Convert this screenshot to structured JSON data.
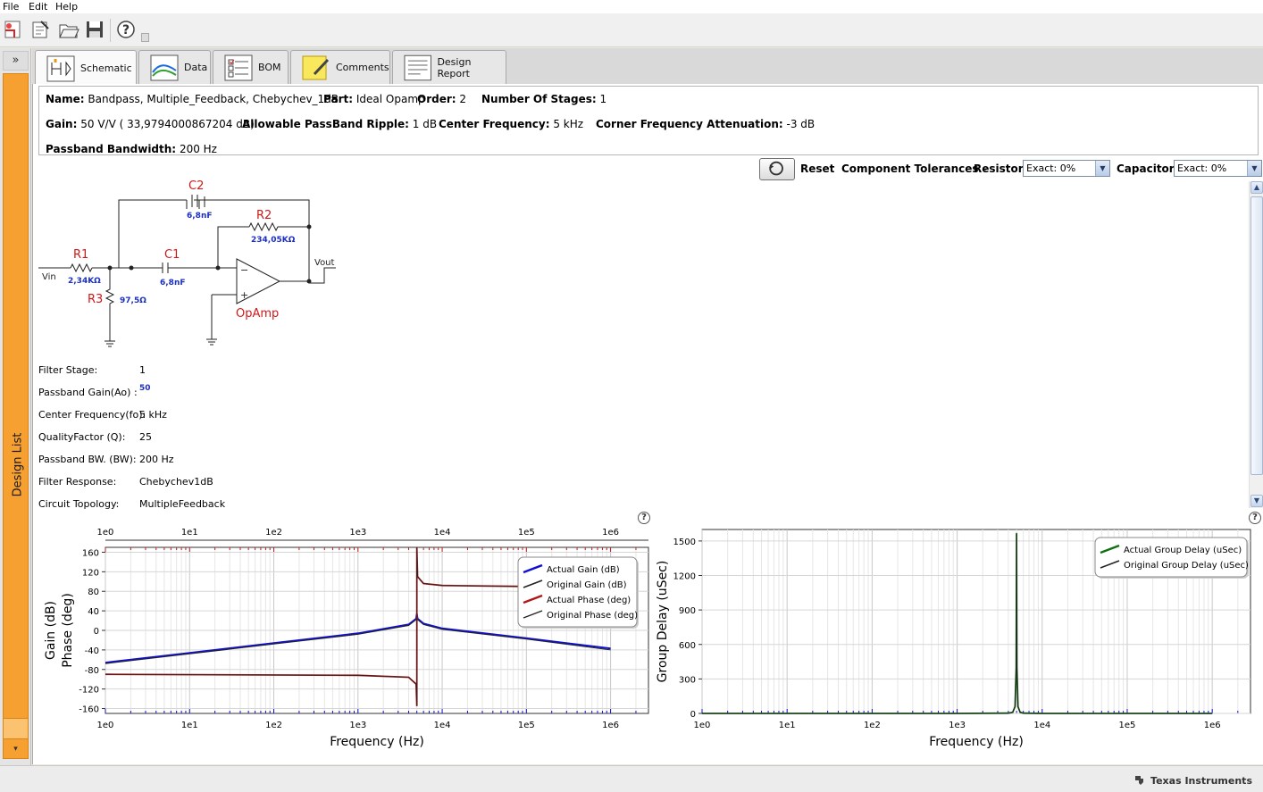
{
  "menu": [
    "File",
    "Edit",
    "Help"
  ],
  "toolbar_icons": [
    "new-design-icon",
    "edit-design-icon",
    "open-folder-icon",
    "save-disk-icon",
    "help-icon"
  ],
  "sidebar": {
    "expand": "»",
    "label": "Design List"
  },
  "tabs": [
    {
      "label": "Schematic",
      "icon": "schematic-icon"
    },
    {
      "label": "Data",
      "icon": "data-chart-icon"
    },
    {
      "label": "BOM",
      "icon": "bom-list-icon"
    },
    {
      "label": "Comments",
      "icon": "comments-note-icon"
    },
    {
      "label": "Design Report",
      "icon": "report-icon"
    }
  ],
  "info": {
    "name_label": "Name:",
    "name": "Bandpass, Multiple_Feedback, Chebychev_1dB",
    "part_label": "Part:",
    "part": "Ideal Opamp",
    "order_label": "Order:",
    "order": "2",
    "stages_label": "Number Of Stages:",
    "stages": "1",
    "gain_label": "Gain:",
    "gain": "50 V/V ( 33,9794000867204 dB)",
    "ripple_label": "Allowable PassBand Ripple:",
    "ripple": "1 dB",
    "cf_label": "Center Frequency:",
    "cf": "5 kHz",
    "cfa_label": "Corner Frequency Attenuation:",
    "cfa": "-3 dB",
    "pbw_label": "Passband Bandwidth:",
    "pbw": "200 Hz"
  },
  "tolerances": {
    "reset": "Reset",
    "title": "Component Tolerances -",
    "resistors_label": "Resistors",
    "resistors_value": "Exact: 0%",
    "capacitors_label": "Capacitors",
    "capacitors_value": "Exact: 0%"
  },
  "schematic": {
    "c2": "C2",
    "c2_val": "6,8nF",
    "r2": "R2",
    "r2_val": "234,05KΩ",
    "r1": "R1",
    "r1_val": "2,34KΩ",
    "c1": "C1",
    "c1_val": "6,8nF",
    "r3": "R3",
    "r3_val": "97,5Ω",
    "vin": "Vin",
    "vout": "Vout",
    "opamp": "OpAmp",
    "minus": "−",
    "plus": "+"
  },
  "stage": [
    {
      "label": "Filter Stage:",
      "value": "1"
    },
    {
      "label": "Passband Gain(Ao) :",
      "value": "50"
    },
    {
      "label": "Center Frequency(fo):",
      "value": "5 kHz"
    },
    {
      "label": "QualityFactor (Q):",
      "value": "25"
    },
    {
      "label": "Passband BW. (BW):",
      "value": "200 Hz"
    },
    {
      "label": "Filter Response:",
      "value": "Chebychev1dB"
    },
    {
      "label": "Circuit Topology:",
      "value": "MultipleFeedback"
    }
  ],
  "colors": {
    "accent_blue": "#1010d0",
    "phase_red": "#b01818",
    "delay_green": "#107010",
    "sidebar_orange": "#f7a032"
  },
  "help_glyph": "?",
  "chart_data": [
    {
      "type": "line",
      "xlabel": "Frequency (Hz)",
      "ylabel": "Gain (dB)",
      "ylabel2": "Phase (deg)",
      "x_scale": "log",
      "x_ticks": [
        "1e0",
        "1e1",
        "1e2",
        "1e3",
        "1e4",
        "1e5",
        "1e6"
      ],
      "y_ticks": [
        "160",
        "120",
        "80",
        "40",
        "0",
        "-40",
        "-80",
        "-120",
        "-160"
      ],
      "ylim": [
        -170,
        170
      ],
      "grid": true,
      "legend": "top-right",
      "series": [
        {
          "name": "Actual Gain (dB)",
          "color": "#1010d0",
          "x": [
            1,
            10,
            100,
            1000,
            4000,
            4900,
            5000,
            5100,
            6000,
            10000,
            100000,
            1000000
          ],
          "y": [
            -66,
            -46,
            -26,
            -6,
            12,
            24,
            34,
            24,
            14,
            4,
            -16,
            -37
          ]
        },
        {
          "name": "Original Gain (dB)",
          "color": "#222222",
          "x": [
            1,
            10,
            100,
            1000,
            4000,
            4900,
            5000,
            5100,
            6000,
            10000,
            100000,
            1000000
          ],
          "y": [
            -68,
            -48,
            -28,
            -8,
            10,
            22,
            32,
            22,
            12,
            2,
            -18,
            -40
          ]
        },
        {
          "name": "Actual Phase (deg)",
          "color": "#b01818",
          "x": [
            1,
            1000,
            4000,
            4900,
            4999,
            5001,
            5100,
            6000,
            10000,
            100000,
            1000000
          ],
          "y": [
            -90,
            -92,
            -96,
            -110,
            -155,
            170,
            110,
            96,
            92,
            90,
            90
          ]
        },
        {
          "name": "Original Phase (deg)",
          "color": "#222222",
          "x": [
            1,
            1000,
            4000,
            4900,
            4999,
            5001,
            5100,
            6000,
            10000,
            100000,
            1000000
          ],
          "y": [
            -90,
            -92,
            -96,
            -110,
            -155,
            170,
            110,
            96,
            92,
            90,
            90
          ]
        }
      ]
    },
    {
      "type": "line",
      "xlabel": "Frequency (Hz)",
      "ylabel": "Group Delay (uSec)",
      "x_scale": "log",
      "x_ticks": [
        "1e0",
        "1e1",
        "1e2",
        "1e3",
        "1e4",
        "1e5",
        "1e6"
      ],
      "y_ticks": [
        "1500",
        "1200",
        "900",
        "600",
        "300",
        "0"
      ],
      "ylim": [
        0,
        1600
      ],
      "grid": true,
      "legend": "top-right",
      "series": [
        {
          "name": "Actual Group Delay (uSec)",
          "color": "#107010",
          "x": [
            1,
            1000,
            4000,
            4500,
            4800,
            4950,
            5000,
            5050,
            5200,
            5500,
            6000,
            10000,
            1000000
          ],
          "y": [
            0,
            0,
            2,
            10,
            60,
            400,
            1570,
            400,
            60,
            10,
            2,
            0,
            0
          ]
        },
        {
          "name": "Original Group Delay (uSec)",
          "color": "#222222",
          "x": [
            1,
            1000,
            4000,
            4500,
            4800,
            4950,
            5000,
            5050,
            5200,
            5500,
            6000,
            10000,
            1000000
          ],
          "y": [
            0,
            0,
            2,
            10,
            60,
            400,
            1560,
            400,
            60,
            10,
            2,
            0,
            0
          ]
        }
      ]
    }
  ],
  "status": {
    "brand": "Texas Instruments"
  }
}
